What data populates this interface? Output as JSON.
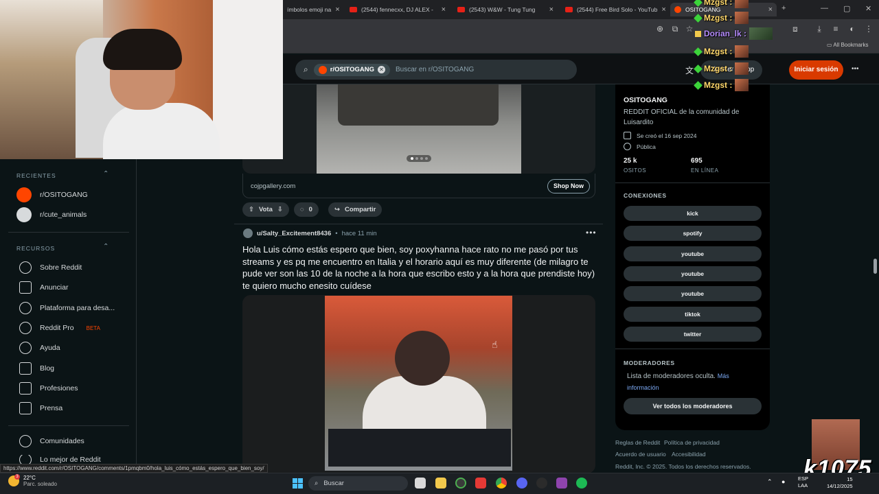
{
  "browser": {
    "tabs": [
      {
        "label": "ímbolos emoji na"
      },
      {
        "label": "(2544) fennecxx, DJ ALEX -"
      },
      {
        "label": "(2543) W&W - Tung Tung"
      },
      {
        "label": "(2544) Free Bird Solo - YouTub"
      },
      {
        "label": "OSITOGANG"
      }
    ],
    "bookmarks_label": "All Bookmarks"
  },
  "header": {
    "search_chip": "r/OSITOGANG",
    "search_placeholder": "Buscar en r/OSITOGANG",
    "get_app": "Obtener la app",
    "login": "Iniciar sesión",
    "more": "•••"
  },
  "sidebar": {
    "recent_title": "RECIENTES",
    "recent": [
      {
        "label": "r/OSITOGANG",
        "color": "#ff4500"
      },
      {
        "label": "r/cute_animals",
        "color": "#d7dadc"
      }
    ],
    "resources_title": "RECURSOS",
    "resources": [
      {
        "label": "Sobre Reddit"
      },
      {
        "label": "Anunciar"
      },
      {
        "label": "Plataforma para desa..."
      },
      {
        "label": "Reddit Pro",
        "badge": "BETA"
      },
      {
        "label": "Ayuda"
      },
      {
        "label": "Blog"
      },
      {
        "label": "Profesiones"
      },
      {
        "label": "Prensa"
      }
    ],
    "communities": "Comunidades",
    "best_of": "Lo mejor de Reddit"
  },
  "feed": {
    "ad_domain": "cojpgallery.com",
    "shop_now": "Shop Now",
    "vote_label": "Vota",
    "comment_count": "0",
    "share_label": "Compartir",
    "post": {
      "author": "u/Salty_Excitement8436",
      "time": "hace 11 min",
      "title": "Hola Luis cómo estás espero que bien, soy poxyhanna hace rato no me pasó por tus streams y es pq me encuentro en Italia y el horario aquí es muy diferente (de milagro te pude ver son las 10 de la noche a la hora que escribo esto y a la hora que prendiste hoy) te quiero mucho enesito cuídese"
    }
  },
  "community": {
    "name": "OSITOGANG",
    "description": "REDDIT OFICIAL de la comunidad de Luisardito",
    "created": "Se creó el 16 sep 2024",
    "visibility": "Pública",
    "members_value": "25 k",
    "members_label": "OSITOS",
    "online_value": "695",
    "online_label": "EN LÍNEA",
    "connections_title": "CONEXIONES",
    "links": [
      "kick",
      "spotify",
      "youtube",
      "youtube",
      "youtube",
      "tiktok",
      "twitter"
    ],
    "moderators_title": "MODERADORES",
    "moderators_text": "Lista de moderadores oculta.",
    "moderators_more": "Más información",
    "view_mods": "Ver todos los moderadores",
    "footer": [
      "Reglas de Reddit",
      "Política de privacidad",
      "Acuerdo de usuario",
      "Accesibilidad",
      "Reddit, Inc. © 2025. Todos los derechos reservados."
    ]
  },
  "chat": [
    {
      "user": "Mzgst :",
      "style": "green"
    },
    {
      "user": "Mzgst :",
      "style": "green"
    },
    {
      "user": "Dorian_lk :",
      "style": "purple"
    },
    {
      "user": "Mzgst :",
      "style": "green"
    },
    {
      "user": "Mzgst :",
      "style": "green"
    },
    {
      "user": "Mzgst :",
      "style": "green"
    }
  ],
  "overlay_brand": "k1075",
  "status_url": "https://www.reddit.com/r/OSITOGANG/comments/1pmqbm0/hola_luis_cómo_estás_espero_que_bien_soy/",
  "taskbar": {
    "temp": "22°C",
    "weather": "Parc. soleado",
    "search": "Buscar",
    "lang1": "ESP",
    "lang2": "LAA",
    "time": "15",
    "date": "14/12/2025",
    "notif_count": "3"
  }
}
